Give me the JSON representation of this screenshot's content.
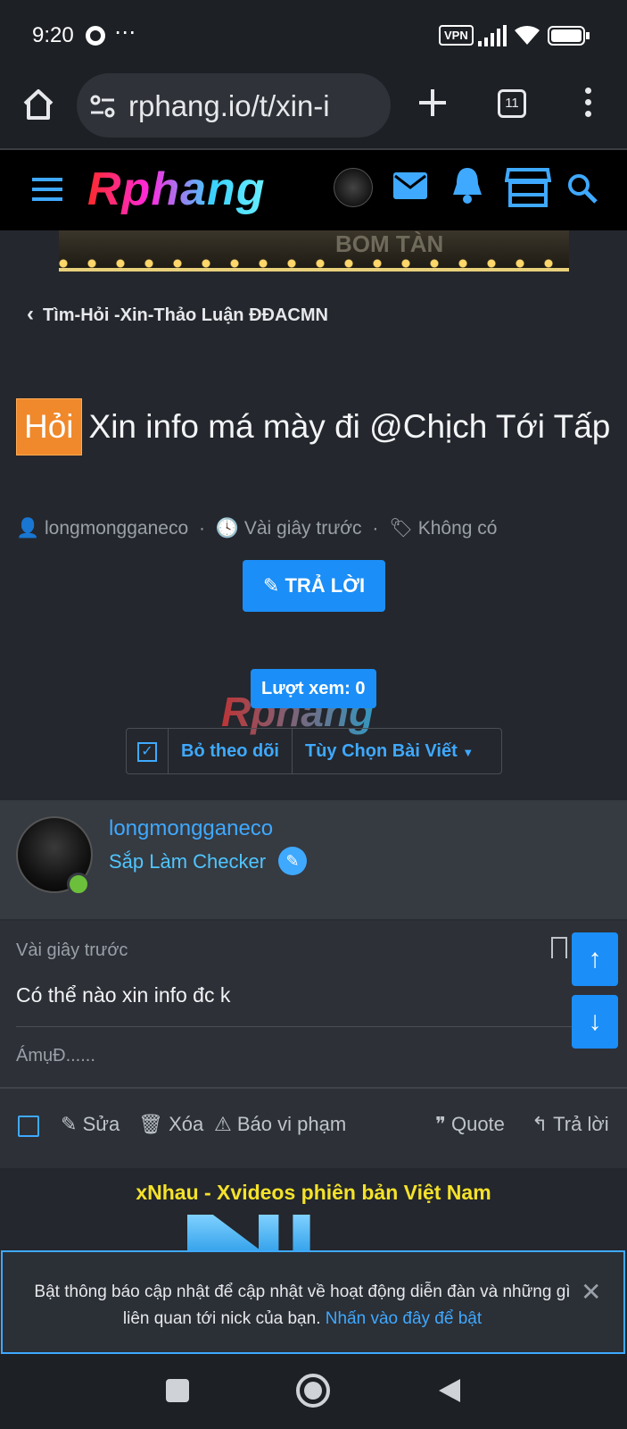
{
  "status_bar": {
    "time": "9:20",
    "dots": "⋯",
    "vpn": "VPN",
    "icons": [
      "chrome-icon",
      "vpn-icon",
      "signal-icon",
      "wifi-icon",
      "battery-icon"
    ]
  },
  "browser": {
    "url": "rphang.io/t/xin-i",
    "tab_count": "11"
  },
  "site": {
    "logo": "Rphang",
    "banner_text": "BOM TÀN"
  },
  "breadcrumb": "Tìm-Hỏi -Xin-Thảo Luận ĐĐACMN",
  "thread": {
    "prefix": "Hỏi",
    "title": "Xin info má mày đi @Chịch Tới Tấp",
    "author": "longmongganeco",
    "time": "Vài giây trước",
    "tags": "Không có",
    "reply_button": "TRẢ LỜI",
    "views": "Lượt xem: 0",
    "watermark": "Rphang",
    "unwatch": "Bỏ theo dõi",
    "options": "Tùy Chọn Bài Viết"
  },
  "post": {
    "username": "longmongganeco",
    "user_title": "Sắp Làm Checker",
    "time": "Vài giây trước",
    "body": "Có thể nào xin info đc k",
    "signature": "ÁmụĐ......",
    "actions": {
      "edit": "Sửa",
      "delete": "Xóa",
      "report": "Báo vi phạm",
      "quote": "Quote",
      "reply": "Trả lời"
    }
  },
  "ad": {
    "title": "xNhau - Xvideos phiên bản Việt Nam"
  },
  "notification": {
    "text": "Bật thông báo cập nhật để cập nhật về hoạt động diễn đàn và những gì liên quan tới nick của bạn.",
    "link": "Nhấn vào đây để bật"
  },
  "colors": {
    "accent": "#1b8ef7",
    "prefix": "#f0892b",
    "background": "#24272d"
  }
}
